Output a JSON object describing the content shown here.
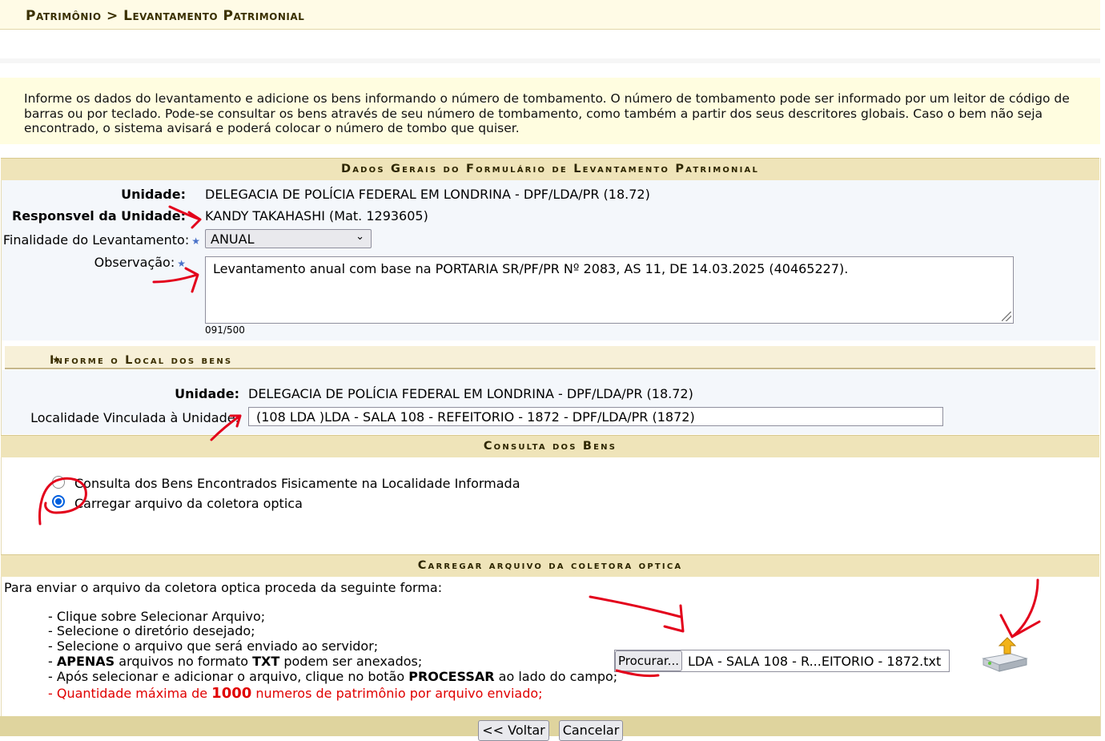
{
  "breadcrumb": "Patrimônio > Levantamento Patrimonial",
  "intro": "Informe os dados do levantamento e adicione os bens informando o número de tombamento. O número de tombamento pode ser informado por um leitor de código de barras ou por teclado. Pode-se consultar os bens através de seu número de tombamento, como também a partir dos seus descritores globais. Caso o bem não seja encontrado, o sistema avisará e poderá colocar o número de tombo que quiser.",
  "dados_gerais": {
    "title": "Dados Gerais do Formulário de Levantamento Patrimonial",
    "unidade_label": "Unidade:",
    "unidade_value": "DELEGACIA DE POLÍCIA FEDERAL EM LONDRINA - DPF/LDA/PR (18.72)",
    "responsavel_label": "Responsvel da Unidade:",
    "responsavel_value": "KANDY TAKAHASHI (Mat. 1293605)",
    "finalidade_label": "Finalidade do Levantamento:",
    "finalidade_value": "ANUAL",
    "observacao_label": "Observação:",
    "observacao_value": "Levantamento anual com base na PORTARIA SR/PF/PR Nº 2083, AS 11, DE 14.03.2025 (40465227).",
    "observacao_counter": "091/500"
  },
  "local": {
    "title": "Informe o Local dos bens",
    "unidade_label": "Unidade:",
    "unidade_value": "DELEGACIA DE POLÍCIA FEDERAL EM LONDRINA - DPF/LDA/PR (18.72)",
    "localidade_label": "Localidade Vinculada à Unidade:",
    "localidade_value": "(108 LDA )LDA - SALA 108 - REFEITORIO - 1872 - DPF/LDA/PR (1872)"
  },
  "consulta": {
    "title": "Consulta dos Bens",
    "options": [
      {
        "label": "Consulta dos Bens Encontrados Fisicamente na Localidade Informada",
        "checked": false
      },
      {
        "label": "Carregar arquivo da coletora optica",
        "checked": true
      }
    ]
  },
  "upload": {
    "title": "Carregar arquivo da coletora optica",
    "intro": "Para enviar o arquivo da coletora optica proceda da seguinte forma:",
    "steps": {
      "s1": "- Clique sobre Selecionar Arquivo;",
      "s2": "- Selecione o diretório desejado;",
      "s3": "- Selecione o arquivo que será enviado ao servidor;",
      "s4_pre": "- ",
      "s4_b1": "APENAS",
      "s4_mid": " arquivos no formato ",
      "s4_b2": "TXT",
      "s4_post": " podem ser anexados;",
      "s5_pre": "- Após selecionar e adicionar o arquivo, clique no botão ",
      "s5_b": "PROCESSAR",
      "s5_post": " ao lado do campo;",
      "s6_pre": "- Quantidade máxima de ",
      "s6_b": "1000",
      "s6_post": " numeros de patrimônio por arquivo enviado;"
    },
    "browse_label": "Procurar...",
    "file_name": "LDA - SALA 108 - R...EITORIO - 1872.txt",
    "process_icon": "upload-drive-icon"
  },
  "footer": {
    "back_label": "<< Voltar",
    "cancel_label": "Cancelar"
  },
  "colors": {
    "section_header": "#efe4b9",
    "info_box": "#fffde0",
    "warning_text": "#e00000",
    "annotation": "#e3001b"
  }
}
